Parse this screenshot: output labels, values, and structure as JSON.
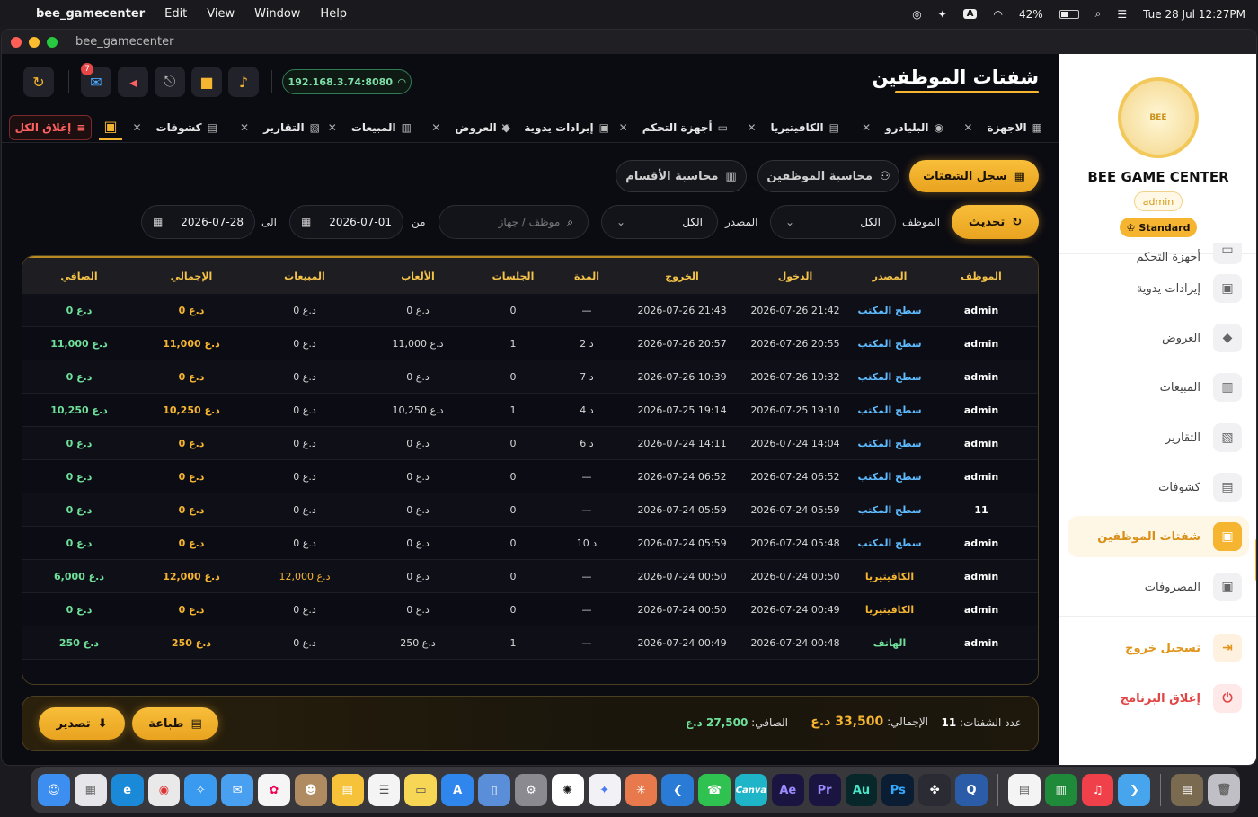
{
  "menubar": {
    "app_name": "bee_gamecenter",
    "items": [
      "Edit",
      "View",
      "Window",
      "Help"
    ],
    "battery": "42%",
    "input_source": "A",
    "datetime": "Tue 28 Jul  12:27PM"
  },
  "window": {
    "title": "bee_gamecenter"
  },
  "header": {
    "page_title": "شفتات الموظفين",
    "ip_address": "192.168.3.74:8080",
    "chat_badge": "7"
  },
  "tabs": {
    "items": [
      "الاجهزة",
      "البليادرو",
      "الكافيتيريا",
      "أجهزة التحكم",
      "إيرادات يدوية",
      "العروض",
      "المبيعات",
      "التقارير",
      "كشوفات"
    ],
    "close_all": "إغلاق الكل"
  },
  "actions": {
    "shift_log": "سجل الشفتات",
    "employees_accounting": "محاسبة الموظفين",
    "sections_accounting": "محاسبة الأقسام"
  },
  "filters": {
    "refresh": "تحديث",
    "employee_label": "الموظف",
    "employee_value": "الكل",
    "source_label": "المصدر",
    "source_value": "الكل",
    "search_placeholder": "موظف / جهاز",
    "from_label": "من",
    "from_date": "2026-07-01",
    "to_label": "الى",
    "to_date": "2026-07-28"
  },
  "table": {
    "columns": [
      "الموظف",
      "المصدر",
      "الدخول",
      "الخروج",
      "المدة",
      "الجلسات",
      "الألعاب",
      "المبيعات",
      "الإجمالي",
      "الصافي"
    ],
    "rows": [
      [
        "admin",
        "سطح المكتب",
        "2026-07-26 21:42",
        "2026-07-26 21:43",
        "—",
        "0",
        "0 د.ع",
        "0 د.ع",
        "0 د.ع",
        "0 د.ع"
      ],
      [
        "admin",
        "سطح المكتب",
        "2026-07-26 20:55",
        "2026-07-26 20:57",
        "2 د",
        "1",
        "11,000 د.ع",
        "0 د.ع",
        "11,000 د.ع",
        "11,000 د.ع"
      ],
      [
        "admin",
        "سطح المكتب",
        "2026-07-26 10:32",
        "2026-07-26 10:39",
        "7 د",
        "0",
        "0 د.ع",
        "0 د.ع",
        "0 د.ع",
        "0 د.ع"
      ],
      [
        "admin",
        "سطح المكتب",
        "2026-07-25 19:10",
        "2026-07-25 19:14",
        "4 د",
        "1",
        "10,250 د.ع",
        "0 د.ع",
        "10,250 د.ع",
        "10,250 د.ع"
      ],
      [
        "admin",
        "سطح المكتب",
        "2026-07-24 14:04",
        "2026-07-24 14:11",
        "6 د",
        "0",
        "0 د.ع",
        "0 د.ع",
        "0 د.ع",
        "0 د.ع"
      ],
      [
        "admin",
        "سطح المكتب",
        "2026-07-24 06:52",
        "2026-07-24 06:52",
        "—",
        "0",
        "0 د.ع",
        "0 د.ع",
        "0 د.ع",
        "0 د.ع"
      ],
      [
        "11",
        "سطح المكتب",
        "2026-07-24 05:59",
        "2026-07-24 05:59",
        "—",
        "0",
        "0 د.ع",
        "0 د.ع",
        "0 د.ع",
        "0 د.ع"
      ],
      [
        "admin",
        "سطح المكتب",
        "2026-07-24 05:48",
        "2026-07-24 05:59",
        "10 د",
        "0",
        "0 د.ع",
        "0 د.ع",
        "0 د.ع",
        "0 د.ع"
      ],
      [
        "admin",
        "الكافيتيريا",
        "2026-07-24 00:50",
        "2026-07-24 00:50",
        "—",
        "0",
        "0 د.ع",
        "12,000 د.ع",
        "12,000 د.ع",
        "6,000 د.ع"
      ],
      [
        "admin",
        "الكافيتيريا",
        "2026-07-24 00:49",
        "2026-07-24 00:50",
        "—",
        "0",
        "0 د.ع",
        "0 د.ع",
        "0 د.ع",
        "0 د.ع"
      ],
      [
        "admin",
        "الهاتف",
        "2026-07-24 00:48",
        "2026-07-24 00:49",
        "—",
        "1",
        "250 د.ع",
        "0 د.ع",
        "250 د.ع",
        "250 د.ع"
      ]
    ]
  },
  "footer": {
    "count_label": "عدد الشفتات:",
    "count_value": "11",
    "total_label": "الإجمالي:",
    "total_value": "33,500 د.ع",
    "net_label": "الصافي:",
    "net_value": "27,500 د.ع",
    "print": "طباعة",
    "export": "تصدير"
  },
  "sidebar": {
    "logo_text": "BEE",
    "brand": "BEE GAME CENTER",
    "role": "admin",
    "plan": "Standard",
    "partial_item": "أجهزة التحكم",
    "items": [
      "إيرادات يدوية",
      "العروض",
      "المبيعات",
      "التقارير",
      "كشوفات",
      "شفتات الموظفين",
      "المصروفات"
    ],
    "logout": "تسجيل خروج",
    "close_app": "إغلاق البرنامج"
  },
  "dock": {
    "apps": [
      "Finder",
      "Launchpad",
      "Edge",
      "Chrome",
      "Safari",
      "Mail",
      "Photos",
      "Contacts",
      "Notes",
      "Reminders",
      "Stickies",
      "App Store",
      "Xcode",
      "Settings",
      "ChatGPT",
      "Gemini",
      "Claude",
      "VS Code",
      "WhatsApp",
      "Canva",
      "Ae",
      "Pr",
      "Au",
      "Ps",
      "DaVinci",
      "QuickTime",
      "Preview",
      "Numbers",
      "Music",
      "Flutter",
      "Folder",
      "Trash"
    ],
    "labels": {
      "canva": "Canva",
      "ae": "Ae",
      "pr": "Pr",
      "au": "Au",
      "ps": "Ps"
    }
  }
}
